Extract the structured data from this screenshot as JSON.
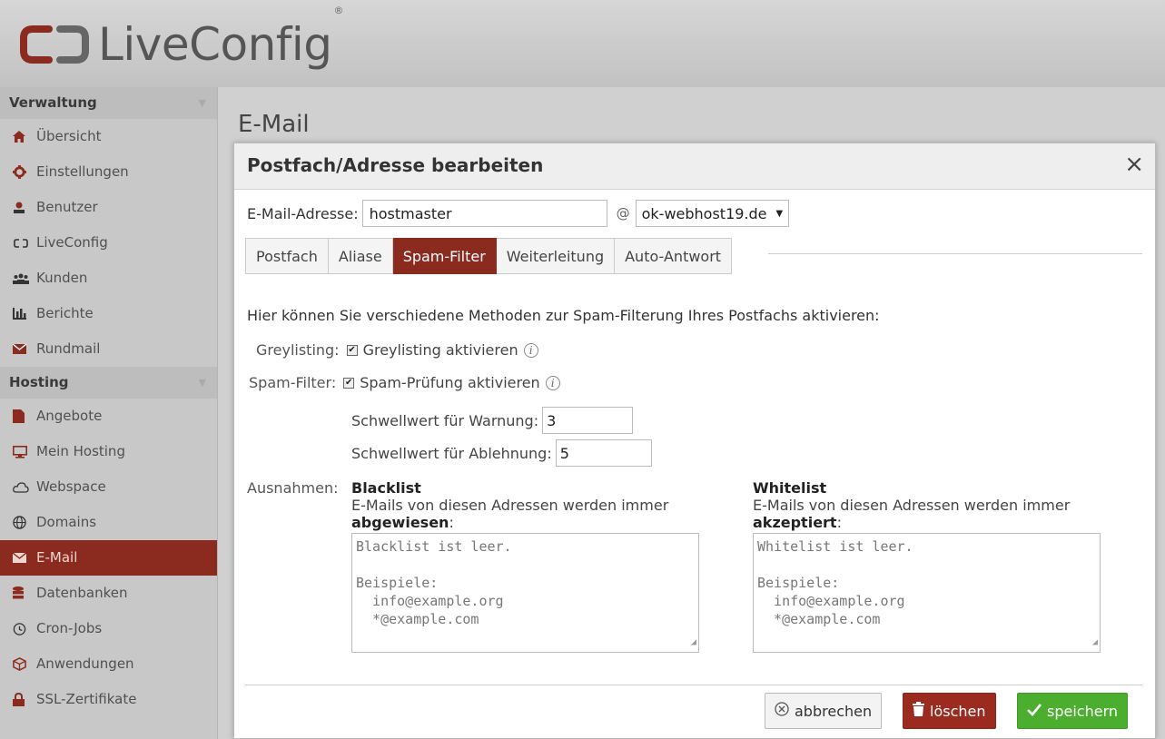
{
  "app": {
    "logo_text": "LiveConfig",
    "logo_reg": "®"
  },
  "page": {
    "title": "E-Mail"
  },
  "sidebar": {
    "sections": [
      {
        "title": "Verwaltung",
        "items": [
          {
            "label": "Übersicht",
            "icon": "home-icon"
          },
          {
            "label": "Einstellungen",
            "icon": "gear-icon"
          },
          {
            "label": "Benutzer",
            "icon": "user-icon"
          },
          {
            "label": "LiveConfig",
            "icon": "liveconfig-icon"
          },
          {
            "label": "Kunden",
            "icon": "customers-icon"
          },
          {
            "label": "Berichte",
            "icon": "bar-chart-icon"
          },
          {
            "label": "Rundmail",
            "icon": "envelope-icon"
          }
        ]
      },
      {
        "title": "Hosting",
        "items": [
          {
            "label": "Angebote",
            "icon": "document-icon"
          },
          {
            "label": "Mein Hosting",
            "icon": "monitor-icon"
          },
          {
            "label": "Webspace",
            "icon": "cloud-icon"
          },
          {
            "label": "Domains",
            "icon": "globe-icon"
          },
          {
            "label": "E-Mail",
            "icon": "envelope-icon",
            "active": true
          },
          {
            "label": "Datenbanken",
            "icon": "database-icon"
          },
          {
            "label": "Cron-Jobs",
            "icon": "clock-icon"
          },
          {
            "label": "Anwendungen",
            "icon": "cube-icon"
          },
          {
            "label": "SSL-Zertifikate",
            "icon": "lock-icon"
          }
        ]
      }
    ]
  },
  "modal": {
    "title": "Postfach/Adresse bearbeiten",
    "close": "×",
    "address_label": "E-Mail-Adresse:",
    "address_value": "hostmaster",
    "at": "@",
    "domain": "ok-webhost19.de",
    "tabs": [
      "Postfach",
      "Aliase",
      "Spam-Filter",
      "Weiterleitung",
      "Auto-Antwort"
    ],
    "active_tab": "Spam-Filter",
    "intro": "Hier können Sie verschiedene Methoden zur Spam-Filterung Ihres Postfachs aktivieren:",
    "greylisting_label": "Greylisting:",
    "greylisting_checkbox": "Greylisting aktivieren",
    "greylisting_checked": true,
    "spamfilter_label": "Spam-Filter:",
    "spamfilter_checkbox": "Spam-Prüfung aktivieren",
    "spamfilter_checked": true,
    "warn_label": "Schwellwert für Warnung:",
    "warn_value": "3",
    "reject_label": "Schwellwert für Ablehnung:",
    "reject_value": "5",
    "exceptions_label": "Ausnahmen:",
    "blacklist": {
      "title": "Blacklist",
      "desc": "E-Mails von diesen Adressen werden immer",
      "desc_bold": "abgewiesen",
      "colon": ":",
      "placeholder": "Blacklist ist leer.\n\nBeispiele:\n  info@example.org\n  *@example.com"
    },
    "whitelist": {
      "title": "Whitelist",
      "desc": "E-Mails von diesen Adressen werden immer",
      "desc_bold": "akzeptiert",
      "colon": ":",
      "placeholder": "Whitelist ist leer.\n\nBeispiele:\n  info@example.org\n  *@example.com"
    },
    "buttons": {
      "cancel": "abbrechen",
      "delete": "löschen",
      "save": "speichern"
    }
  },
  "colors": {
    "accent": "#8b2a1f",
    "save": "#4cae2f",
    "delete": "#9a2b1e"
  }
}
